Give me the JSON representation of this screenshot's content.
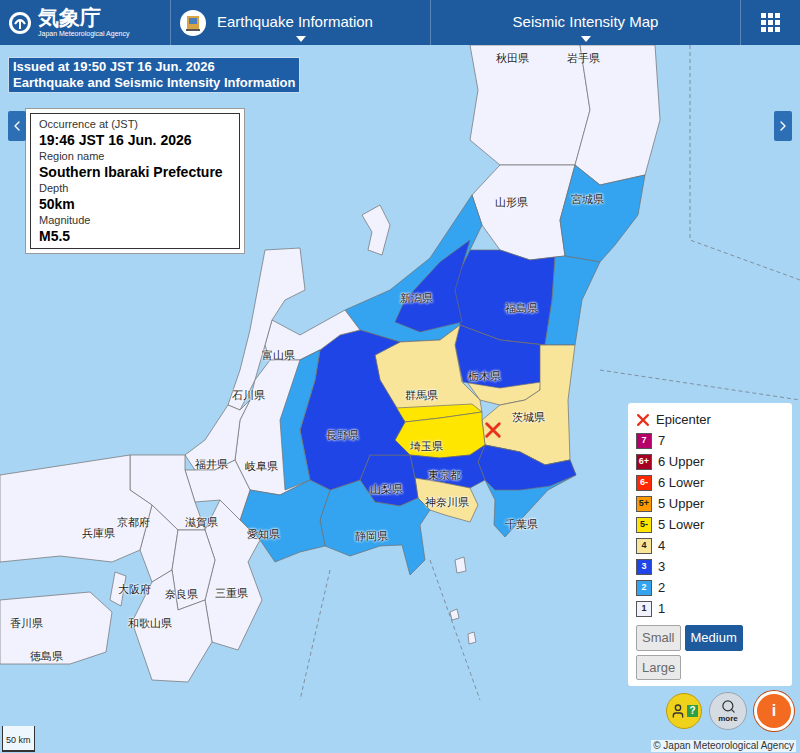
{
  "header": {
    "agency_name": "気象庁",
    "agency_subtitle": "Japan Meteorological Agency",
    "nav": [
      {
        "label": "Earthquake Information"
      },
      {
        "label": "Seismic Intensity Map"
      }
    ]
  },
  "issued": {
    "line1": "Issued at 19:50 JST 16 Jun. 2026",
    "line2": "Earthquake and Seismic Intensity Information"
  },
  "event": {
    "fields": [
      {
        "label": "Occurrence at (JST)",
        "value": "19:46 JST 16 Jun. 2026"
      },
      {
        "label": "Region name",
        "value": "Southern Ibaraki Prefecture"
      },
      {
        "label": "Depth",
        "value": "50km"
      },
      {
        "label": "Magnitude",
        "value": "M5.5"
      }
    ]
  },
  "map": {
    "prefectures": [
      {
        "name": "秋田県"
      },
      {
        "name": "岩手県"
      },
      {
        "name": "山形県"
      },
      {
        "name": "宮城県"
      },
      {
        "name": "新潟県"
      },
      {
        "name": "福島県"
      },
      {
        "name": "富山県"
      },
      {
        "name": "石川県"
      },
      {
        "name": "群馬県"
      },
      {
        "name": "栃木県"
      },
      {
        "name": "茨城県"
      },
      {
        "name": "長野県"
      },
      {
        "name": "埼玉県"
      },
      {
        "name": "福井県"
      },
      {
        "name": "岐阜県"
      },
      {
        "name": "東京都"
      },
      {
        "name": "山梨県"
      },
      {
        "name": "神奈川県"
      },
      {
        "name": "千葉県"
      },
      {
        "name": "京都府"
      },
      {
        "name": "滋賀県"
      },
      {
        "name": "兵庫県"
      },
      {
        "name": "愛知県"
      },
      {
        "name": "静岡県"
      },
      {
        "name": "大阪府"
      },
      {
        "name": "三重県"
      },
      {
        "name": "奈良県"
      },
      {
        "name": "和歌山県"
      },
      {
        "name": "香川県"
      },
      {
        "name": "徳島県"
      }
    ],
    "areas": [
      {
        "intensity": "1"
      },
      {
        "intensity": "1"
      },
      {
        "intensity": "1"
      },
      {
        "intensity": "2"
      },
      {
        "intensity": "1"
      },
      {
        "intensity": "3"
      },
      {
        "intensity": "2"
      },
      {
        "intensity": "2"
      },
      {
        "intensity": "3"
      },
      {
        "intensity": "4"
      },
      {
        "intensity": "3"
      },
      {
        "intensity": "4"
      },
      {
        "intensity": "4"
      },
      {
        "intensity": "5-"
      },
      {
        "intensity": "5-"
      },
      {
        "intensity": "2"
      },
      {
        "intensity": "3"
      },
      {
        "intensity": "3"
      },
      {
        "intensity": "4"
      },
      {
        "intensity": "3"
      },
      {
        "intensity": "2"
      },
      {
        "intensity": "3"
      },
      {
        "intensity": "1"
      },
      {
        "intensity": "1"
      },
      {
        "intensity": "1"
      },
      {
        "intensity": "2"
      },
      {
        "intensity": "1"
      },
      {
        "intensity": "2"
      },
      {
        "intensity": "1"
      },
      {
        "intensity": "1"
      },
      {
        "intensity": "1"
      },
      {
        "intensity": "1"
      },
      {
        "intensity": "1"
      },
      {
        "intensity": "1"
      },
      {
        "intensity": "1"
      },
      {
        "intensity": "1"
      },
      {
        "intensity": "1"
      },
      {
        "intensity": "1"
      },
      {
        "intensity": "1"
      },
      {
        "intensity": "1"
      }
    ],
    "epicenter": {
      "shown": true
    }
  },
  "legend": {
    "epicenter_label": "Epicenter",
    "items": [
      {
        "badge": "7",
        "label": "7",
        "color": "#b40068"
      },
      {
        "badge": "6+",
        "label": "6 Upper",
        "color": "#a50021"
      },
      {
        "badge": "6-",
        "label": "6 Lower",
        "color": "#ff2800"
      },
      {
        "badge": "5+",
        "label": "5 Upper",
        "color": "#ff9900"
      },
      {
        "badge": "5-",
        "label": "5 Lower",
        "color": "#ffe600"
      },
      {
        "badge": "4",
        "label": "4",
        "color": "#f8e59a"
      },
      {
        "badge": "3",
        "label": "3",
        "color": "#1f45e6"
      },
      {
        "badge": "2",
        "label": "2",
        "color": "#34a4f0"
      },
      {
        "badge": "1",
        "label": "1",
        "color": "#f2f2ff"
      }
    ],
    "sizes": [
      {
        "label": "Small",
        "selected": false
      },
      {
        "label": "Medium",
        "selected": true
      },
      {
        "label": "Large",
        "selected": false
      }
    ]
  },
  "tools": [
    {
      "glyph": "?"
    },
    {
      "glyph": "more"
    },
    {
      "glyph": "i"
    }
  ],
  "scale": "50 km",
  "copyright": "© Japan Meteorological Agency"
}
